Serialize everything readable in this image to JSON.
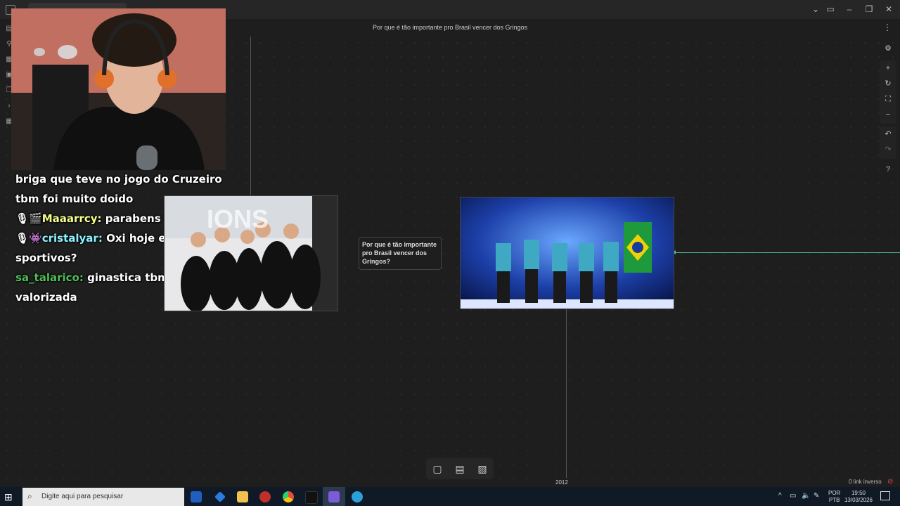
{
  "window": {
    "title": "Por que é tão importante pro Brasil vencer dos Gringos",
    "tab_label": "",
    "controls": {
      "minimize": "–",
      "maximize": "❐",
      "close": "✕"
    }
  },
  "chat": {
    "lines": [
      {
        "user": "",
        "message": "briga que teve no jogo do Cruzeiro",
        "user_color": "#ffffff"
      },
      {
        "user": "",
        "message": "tbm foi muito doido",
        "user_color": "#ffffff"
      },
      {
        "user": "Maaarrcy:",
        "message": "parabens cali",
        "user_color": "#f6ff8c"
      },
      {
        "user": "cristalyar:",
        "message": "Oxi hoje estamos",
        "user_color": "#8cf2ff"
      },
      {
        "user": "",
        "message": "sportivos?",
        "user_color": "#ffffff"
      },
      {
        "user": "sa_talarico:",
        "message": "ginastica tbm n é nada",
        "user_color": "#4fbf55"
      },
      {
        "user": "",
        "message": "valorizada",
        "user_color": "#ffffff"
      }
    ]
  },
  "canvas": {
    "text_card": "Por que é tão importante pro Brasil vencer dos Gringos?",
    "year_label": "2012",
    "backlinks": "0 link inverso",
    "edge_color": "#4fb39a"
  },
  "right_tools": [
    "gear-icon",
    "plus-icon",
    "refresh-icon",
    "fit-icon",
    "minus-icon",
    "undo-icon",
    "redo-icon",
    "help-icon"
  ],
  "bottom_toolbar": [
    "card-icon",
    "note-icon",
    "media-icon"
  ],
  "taskbar": {
    "search_placeholder": "Digite aqui para pesquisar",
    "lang_top": "POR",
    "lang_bottom": "PTB",
    "time": "19:50",
    "date": "13/03/2026"
  }
}
